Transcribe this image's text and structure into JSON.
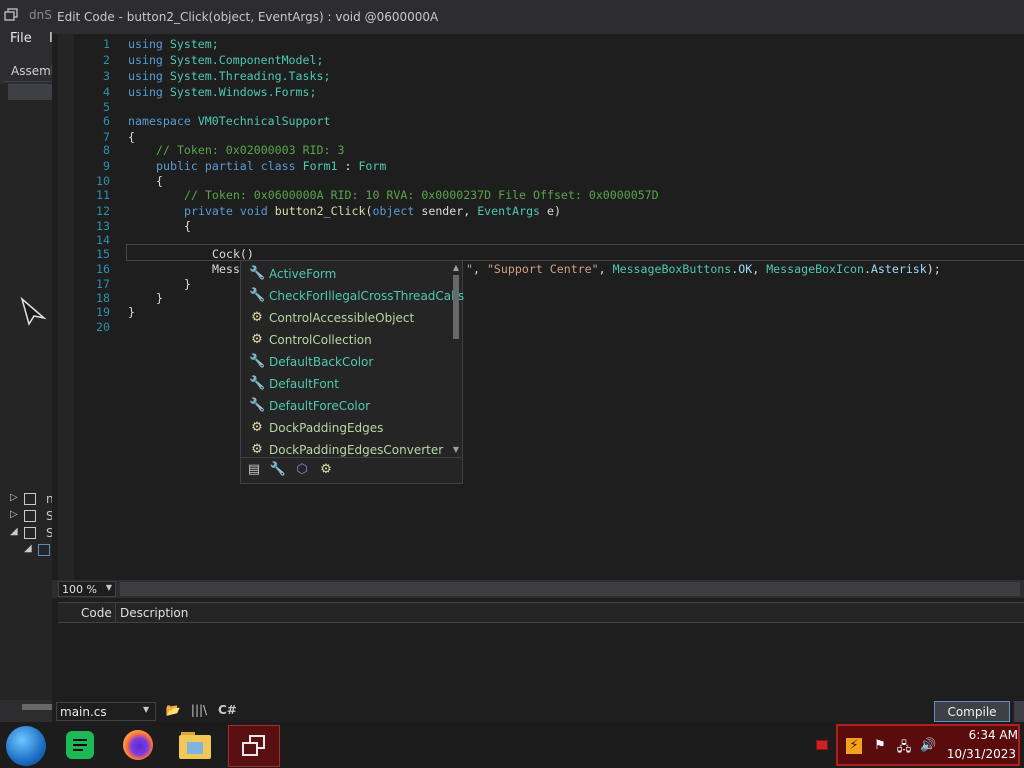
{
  "background_app": {
    "title_fragment": "dnSp",
    "menu": [
      "File",
      "I"
    ],
    "assembly_tab": "Assemb",
    "tree_rows": [
      {
        "label": "n",
        "expanded": false
      },
      {
        "label": "S",
        "expanded": false
      },
      {
        "label": "S",
        "expanded": true
      }
    ]
  },
  "dialog": {
    "title": "Edit Code - button2_Click(object, EventArgs) : void @0600000A",
    "line_numbers": [
      "1",
      "2",
      "3",
      "4",
      "5",
      "6",
      "7",
      "8",
      "9",
      "10",
      "11",
      "12",
      "13",
      "14",
      "15",
      "16",
      "17",
      "18",
      "19",
      "20"
    ],
    "code": {
      "l1_kw": "using",
      "l1_ns": "System;",
      "l2_kw": "using",
      "l2_ns": "System.ComponentModel;",
      "l3_kw": "using",
      "l3_ns": "System.Threading.Tasks;",
      "l4_kw": "using",
      "l4_ns": "System.Windows.Forms;",
      "l6_kw": "namespace",
      "l6_ns": "VM0TechnicalSupport",
      "l7": "{",
      "l8": "// Token: 0x02000003 RID: 3",
      "l9_kw": "public partial class",
      "l9_cls": "Form1",
      "l9_sep": " : ",
      "l9_base": "Form",
      "l10": "{",
      "l11": "// Token: 0x0600000A RID: 10 RVA: 0x0000237D File Offset: 0x0000057D",
      "l12_kw": "private void",
      "l12_fn": "button2_Click",
      "l12_p1": "(",
      "l12_kw2": "object",
      "l12_p2": " sender, ",
      "l12_ty": "EventArgs",
      "l12_p3": " e)",
      "l13": "{",
      "l15": "Cock()",
      "l16_start": "Mess",
      "l16_str_end": "\"",
      "l16_sep1": ", ",
      "l16_str2": "\"Support Centre\"",
      "l16_sep2": ", ",
      "l16_ty1": "MessageBoxButtons",
      "l16_dot1": ".",
      "l16_en1": "OK",
      "l16_sep3": ", ",
      "l16_ty2": "MessageBoxIcon",
      "l16_dot2": ".",
      "l16_en2": "Asterisk",
      "l16_end": ");",
      "l17": "}",
      "l18": "}",
      "l19": "}"
    },
    "completion": {
      "items": [
        {
          "label": "ActiveForm",
          "kind": "property",
          "icon": "wrench-icon"
        },
        {
          "label": "CheckForIllegalCrossThreadCalls",
          "kind": "property",
          "icon": "wrench-icon"
        },
        {
          "label": "ControlAccessibleObject",
          "kind": "class",
          "icon": "class-icon"
        },
        {
          "label": "ControlCollection",
          "kind": "class",
          "icon": "class-icon"
        },
        {
          "label": "DefaultBackColor",
          "kind": "property",
          "icon": "wrench-icon"
        },
        {
          "label": "DefaultFont",
          "kind": "property",
          "icon": "wrench-icon"
        },
        {
          "label": "DefaultForeColor",
          "kind": "property",
          "icon": "wrench-icon"
        },
        {
          "label": "DockPaddingEdges",
          "kind": "class",
          "icon": "class-icon"
        },
        {
          "label": "DockPaddingEdgesConverter",
          "kind": "class",
          "icon": "class-icon"
        }
      ],
      "filters": [
        "list-filter-icon",
        "wrench-filter-icon",
        "cube-filter-icon",
        "class-filter-icon"
      ],
      "colors": {
        "property": "#4ec9b0",
        "class": "#b8d7a3",
        "background": "#252526"
      }
    },
    "zoom": "100 %",
    "error_list": {
      "col_code": "Code",
      "col_description": "Description"
    },
    "bottom": {
      "file": "main.cs",
      "language_label": "C#",
      "compile_label": "Compile"
    }
  },
  "taskbar": {
    "apps": [
      "start-orb-icon",
      "spotify-icon",
      "firefox-icon",
      "file-explorer-icon",
      "dnspy-icon"
    ],
    "time": "6:34 AM",
    "date": "10/31/2023"
  }
}
